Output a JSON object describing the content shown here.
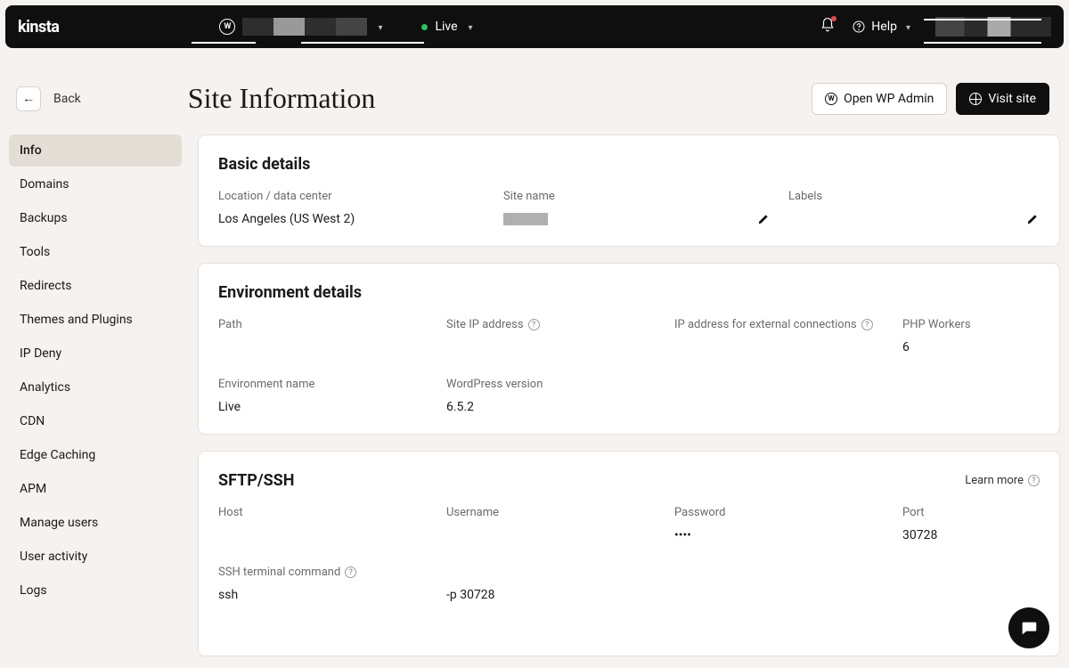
{
  "topbar": {
    "brand": "kinsta",
    "env_label": "Live",
    "help_label": "Help"
  },
  "header": {
    "back_label": "Back",
    "page_title": "Site Information",
    "open_wp_admin": "Open WP Admin",
    "visit_site": "Visit site"
  },
  "sidebar": {
    "items": [
      "Info",
      "Domains",
      "Backups",
      "Tools",
      "Redirects",
      "Themes and Plugins",
      "IP Deny",
      "Analytics",
      "CDN",
      "Edge Caching",
      "APM",
      "Manage users",
      "User activity",
      "Logs"
    ],
    "active_index": 0
  },
  "basic_details": {
    "title": "Basic details",
    "location_label": "Location / data center",
    "location_value": "Los Angeles (US West 2)",
    "sitename_label": "Site name",
    "labels_label": "Labels"
  },
  "env_details": {
    "title": "Environment details",
    "path_label": "Path",
    "site_ip_label": "Site IP address",
    "ext_ip_label": "IP address for external connections",
    "php_workers_label": "PHP Workers",
    "php_workers_value": "6",
    "env_name_label": "Environment name",
    "env_name_value": "Live",
    "wp_version_label": "WordPress version",
    "wp_version_value": "6.5.2"
  },
  "sftp": {
    "title": "SFTP/SSH",
    "learn_more": "Learn more",
    "host_label": "Host",
    "username_label": "Username",
    "password_label": "Password",
    "password_value": "••••",
    "port_label": "Port",
    "port_value": "30728",
    "ssh_cmd_label": "SSH terminal command",
    "ssh_cmd_value_a": "ssh",
    "ssh_cmd_value_b": "-p 30728"
  }
}
